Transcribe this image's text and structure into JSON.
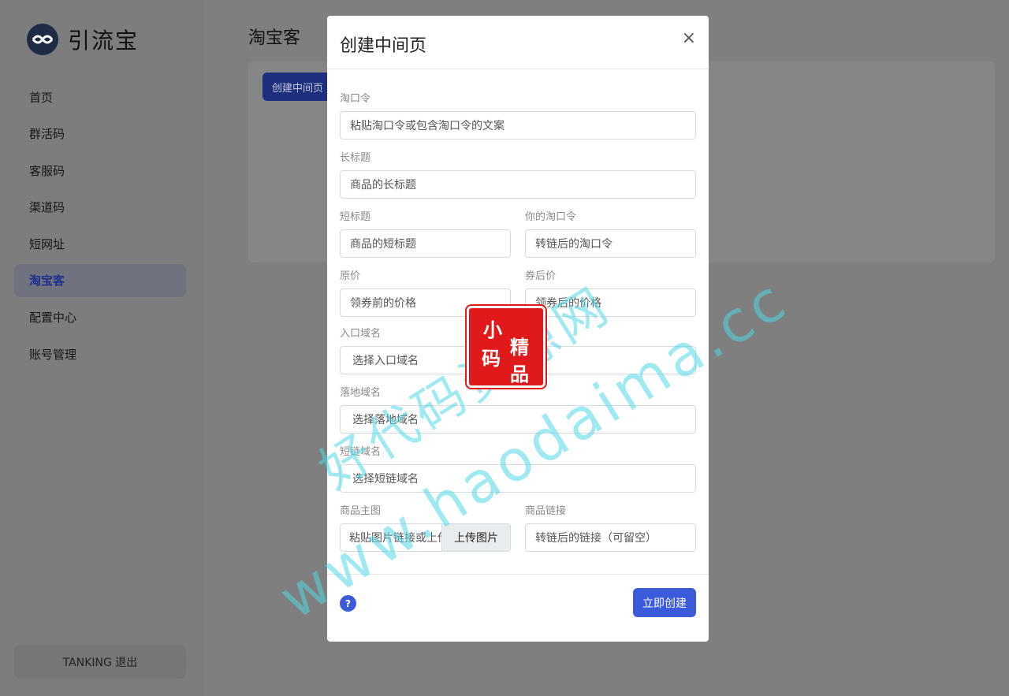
{
  "app": {
    "name": "引流宝"
  },
  "sidebar": {
    "items": [
      {
        "label": "首页",
        "active": false
      },
      {
        "label": "群活码",
        "active": false
      },
      {
        "label": "客服码",
        "active": false
      },
      {
        "label": "渠道码",
        "active": false
      },
      {
        "label": "短网址",
        "active": false
      },
      {
        "label": "淘宝客",
        "active": true
      },
      {
        "label": "配置中心",
        "active": false
      },
      {
        "label": "账号管理",
        "active": false
      }
    ],
    "logout": "TANKING  退出"
  },
  "main": {
    "title": "淘宝客",
    "create_button": "创建中间页"
  },
  "modal": {
    "title": "创建中间页",
    "close": "×",
    "fields": {
      "tkl": {
        "label": "淘口令",
        "placeholder": "粘贴淘口令或包含淘口令的文案"
      },
      "long_title": {
        "label": "长标题",
        "placeholder": "商品的长标题"
      },
      "short_title": {
        "label": "短标题",
        "placeholder": "商品的短标题"
      },
      "your_tkl": {
        "label": "你的淘口令",
        "placeholder": "转链后的淘口令"
      },
      "original_price": {
        "label": "原价",
        "placeholder": "领券前的价格"
      },
      "coupon_price": {
        "label": "券后价",
        "placeholder": "领券后的价格"
      },
      "entry_domain": {
        "label": "入口域名",
        "placeholder": "选择入口域名"
      },
      "landing_domain": {
        "label": "落地域名",
        "placeholder": "选择落地域名"
      },
      "short_domain": {
        "label": "短链域名",
        "placeholder": "选择短链域名"
      },
      "main_image": {
        "label": "商品主图",
        "placeholder": "粘贴图片链接或上传",
        "upload": "上传图片"
      },
      "product_link": {
        "label": "商品链接",
        "placeholder": "转链后的链接（可留空）"
      }
    },
    "help_icon": "?",
    "submit": "立即创建"
  },
  "watermark": {
    "text": "www.haodaima.cc 好代码资源网",
    "stamp": "小码精品"
  },
  "colors": {
    "accent": "#3b5bdb",
    "overlay": "#7f7f7f"
  }
}
